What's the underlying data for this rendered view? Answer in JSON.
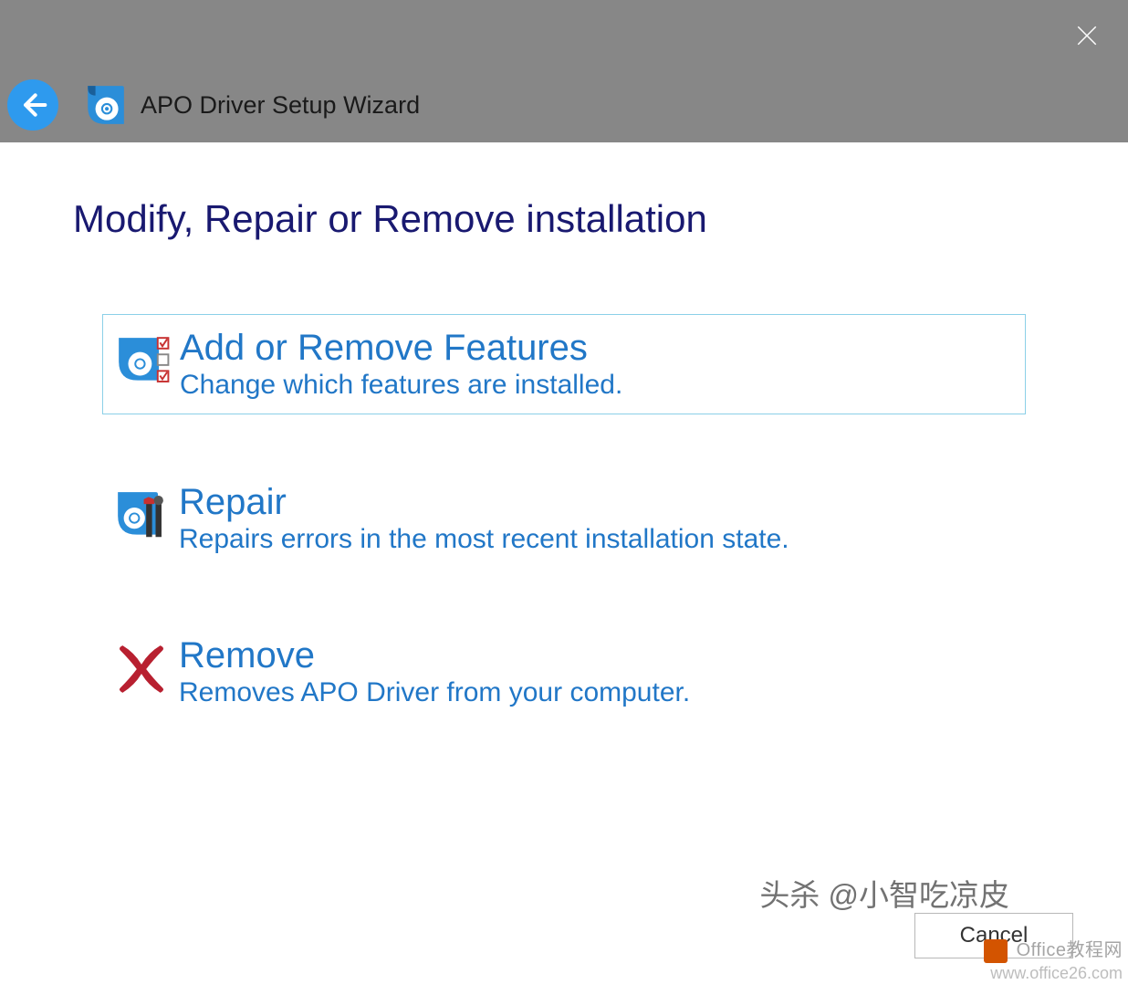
{
  "header": {
    "app_title": "APO Driver Setup Wizard"
  },
  "page": {
    "heading": "Modify, Repair or Remove installation"
  },
  "options": {
    "add_remove": {
      "title": "Add or Remove Features",
      "desc": "Change which features are installed."
    },
    "repair": {
      "title": "Repair",
      "desc": "Repairs errors in the most recent installation state."
    },
    "remove": {
      "title": "Remove",
      "desc": "Removes APO Driver from your computer."
    }
  },
  "footer": {
    "cancel_label": "Cancel"
  },
  "watermark": {
    "text1": "头杀 @小智吃凉皮",
    "text2a": "Office教程网",
    "text2b": "www.office26.com"
  }
}
